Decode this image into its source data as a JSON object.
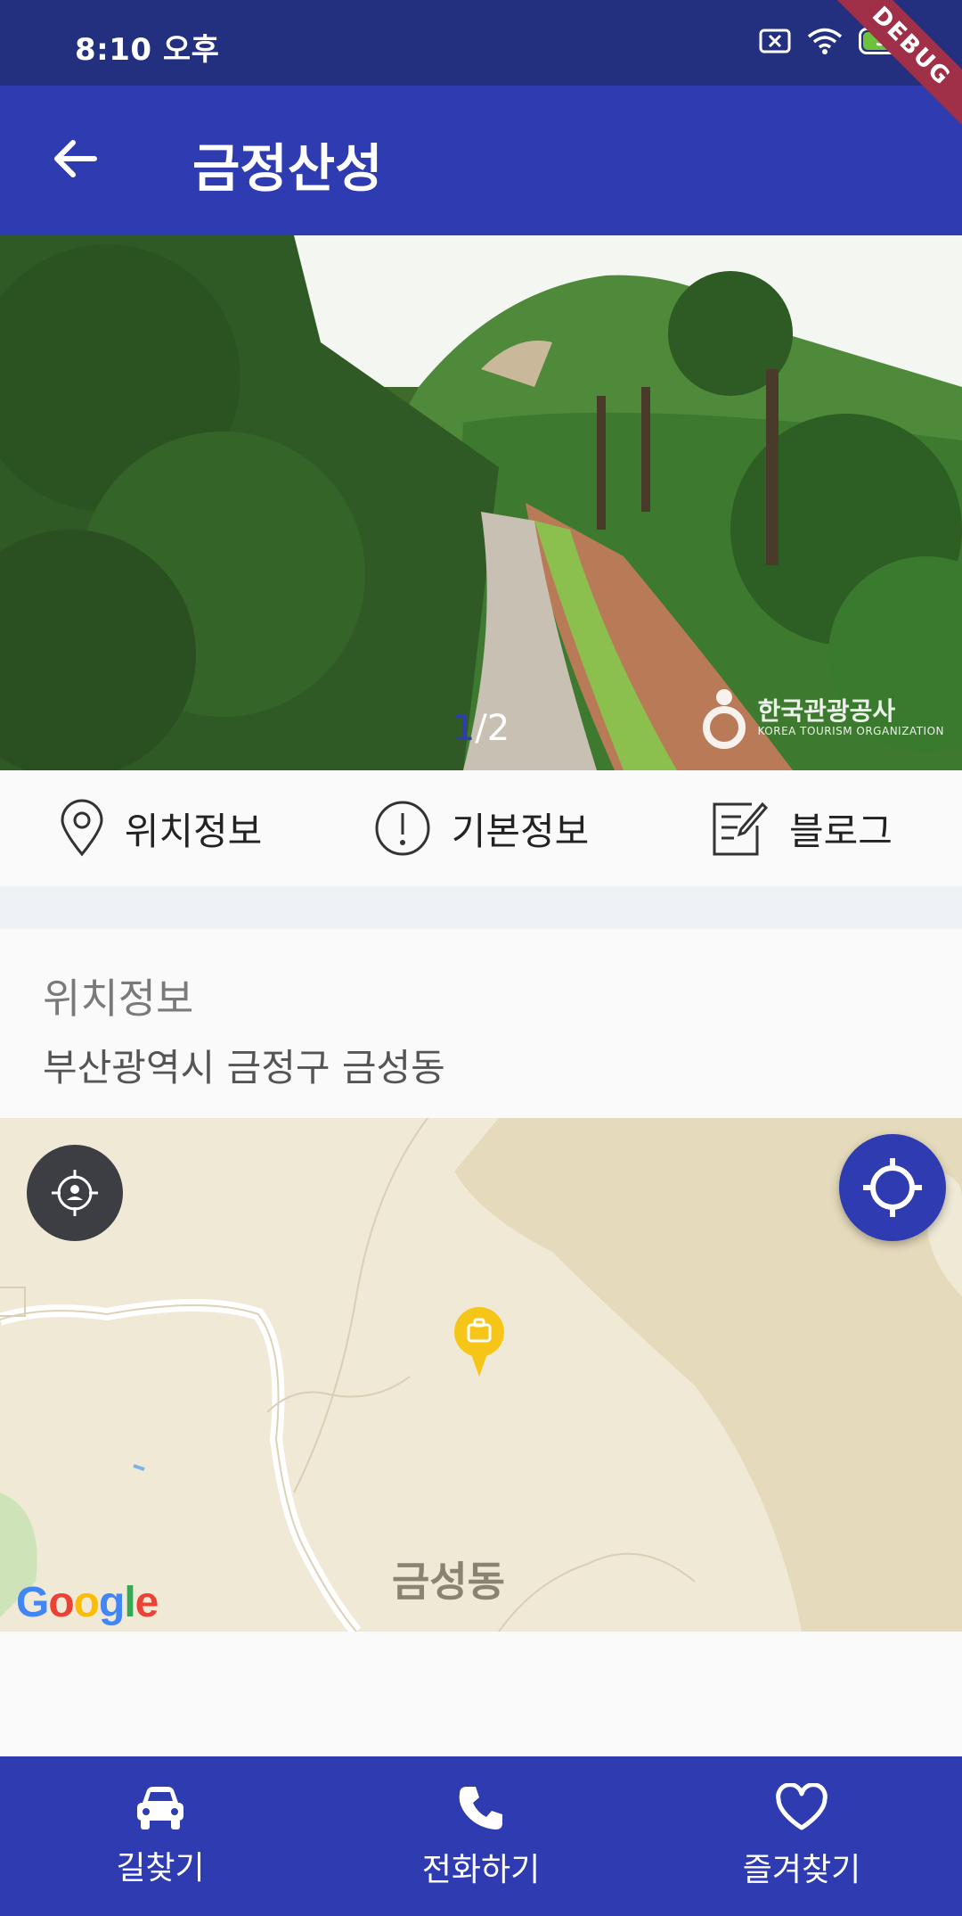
{
  "status_bar": {
    "time": "8:10 오후",
    "battery": "97",
    "debug_banner": "DEBUG"
  },
  "app_bar": {
    "title": "금정산성",
    "back_icon": "arrow-left-icon"
  },
  "photo": {
    "page_current": "1",
    "page_separator": "/",
    "page_total": "2",
    "watermark": "한국관광공사",
    "watermark_sub": "KOREA TOURISM ORGANIZATION"
  },
  "tabs": [
    {
      "label": "위치정보",
      "icon": "location-pin-icon"
    },
    {
      "label": "기본정보",
      "icon": "info-circle-icon"
    },
    {
      "label": "블로그",
      "icon": "edit-note-icon"
    }
  ],
  "location": {
    "title": "위치정보",
    "address": "부산광역시 금정구 금성동"
  },
  "map": {
    "place_label": "금성동",
    "google_logo": "Google",
    "marker_color": "#f5c518"
  },
  "bottom_nav": [
    {
      "label": "길찾기",
      "icon": "car-icon"
    },
    {
      "label": "전화하기",
      "icon": "phone-icon"
    },
    {
      "label": "즐겨찾기",
      "icon": "heart-icon"
    }
  ],
  "colors": {
    "primary": "#2e3bb1",
    "status_bar": "#23307f"
  }
}
